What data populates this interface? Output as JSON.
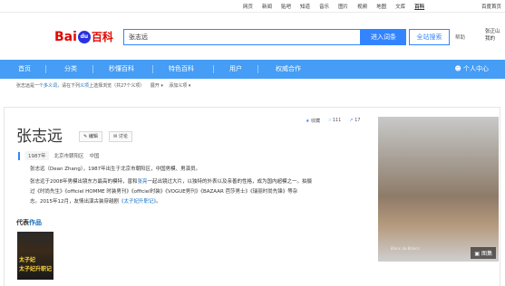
{
  "topnav": {
    "links": [
      {
        "label": "网页",
        "active": false
      },
      {
        "label": "新闻",
        "active": false
      },
      {
        "label": "贴吧",
        "active": false
      },
      {
        "label": "知道",
        "active": false
      },
      {
        "label": "音乐",
        "active": false
      },
      {
        "label": "图片",
        "active": false
      },
      {
        "label": "视频",
        "active": false
      },
      {
        "label": "地图",
        "active": false
      },
      {
        "label": "文库",
        "active": false
      },
      {
        "label": "百科",
        "active": true
      }
    ],
    "right_link": "百度首页"
  },
  "header": {
    "logo_bai": "Bai",
    "logo_du": "du",
    "logo_baike": "百科",
    "search_value": "张志远",
    "enter_button": "进入词条",
    "all_search_button": "全站搜索",
    "help": "帮助",
    "user_line1": "张正山",
    "user_line2": "我的"
  },
  "mainnav": {
    "items": [
      "首页",
      "分类",
      "秒懂百科",
      "特色百科",
      "用户",
      "权威合作"
    ],
    "personal": "个人中心",
    "bg_color": "#459df5"
  },
  "disambig": {
    "text1": "张志远是一个",
    "link1": "多义词",
    "text2": "，请在下列",
    "link2": "义项",
    "text3": "上选择浏览（共27个义项）",
    "expand": "展开",
    "add": "添加义项"
  },
  "entry": {
    "title": "张志远",
    "edit": "编辑",
    "discuss": "讨论",
    "actions": {
      "collect": "收藏",
      "likes": "111",
      "shares": "17"
    },
    "meta": [
      "1987年",
      "北京市朝阳区",
      "中国"
    ],
    "para1": "张志远（Dean Zhang），1987年出生于北京市朝阳区，中国男模、男演员。",
    "para2_a": "张志远于2008年男模出镜东方最高的模特，曾和",
    "para2_link": "张亮",
    "para2_b": "一起出镜过大片，以独特的外表以及亲善的性格，成为国内超模之一。拍摄",
    "para3": "过《时尚先生》《officiel HOMME 时装男刊》《officiel时装》《VOGUE男刊》《BAZAAR 芭莎男士》《瑞丽时尚先锋》等杂",
    "para4_a": "志。2015年12月，友情出演古装穿越剧",
    "para4_link": "《太子妃升职记》",
    "para4_b": "。",
    "rep_label": "代表",
    "rep_link": "作品",
    "poster_cap1": "太子妃",
    "poster_cap2": "太子妃升职记",
    "photo_caption": "Blanc de Blancs",
    "gallery": "图集"
  }
}
